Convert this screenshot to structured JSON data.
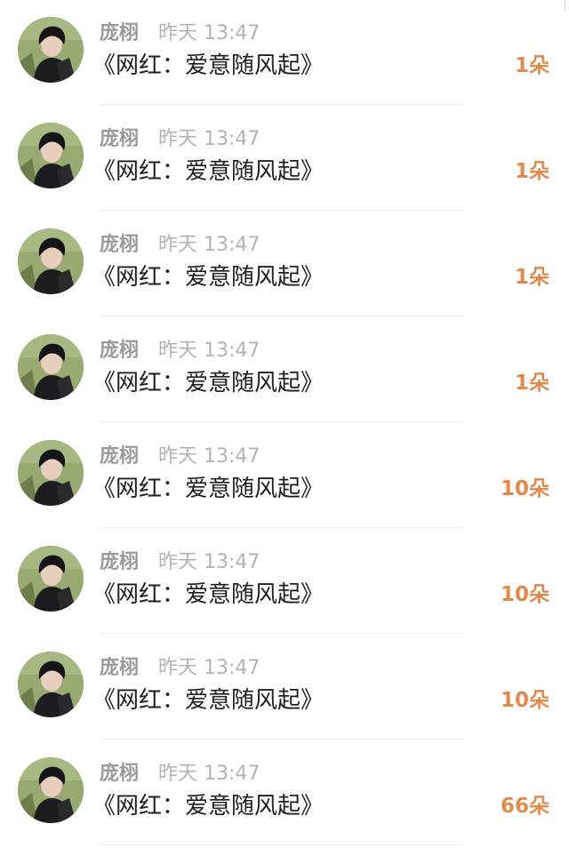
{
  "colors": {
    "name": "#9a9a9a",
    "time": "#b3b3b3",
    "title": "#1f1f1f",
    "amount": "#e08a4e",
    "divider": "#ededed"
  },
  "gifts": [
    {
      "name": "庞栩",
      "time": "昨天 13:47",
      "title": "《网红：爱意随风起》",
      "amount": "1朵",
      "avatar": "user-avatar"
    },
    {
      "name": "庞栩",
      "time": "昨天 13:47",
      "title": "《网红：爱意随风起》",
      "amount": "1朵",
      "avatar": "user-avatar"
    },
    {
      "name": "庞栩",
      "time": "昨天 13:47",
      "title": "《网红：爱意随风起》",
      "amount": "1朵",
      "avatar": "user-avatar"
    },
    {
      "name": "庞栩",
      "time": "昨天 13:47",
      "title": "《网红：爱意随风起》",
      "amount": "1朵",
      "avatar": "user-avatar"
    },
    {
      "name": "庞栩",
      "time": "昨天 13:47",
      "title": "《网红：爱意随风起》",
      "amount": "10朵",
      "avatar": "user-avatar"
    },
    {
      "name": "庞栩",
      "time": "昨天 13:47",
      "title": "《网红：爱意随风起》",
      "amount": "10朵",
      "avatar": "user-avatar"
    },
    {
      "name": "庞栩",
      "time": "昨天 13:47",
      "title": "《网红：爱意随风起》",
      "amount": "10朵",
      "avatar": "user-avatar"
    },
    {
      "name": "庞栩",
      "time": "昨天 13:47",
      "title": "《网红：爱意随风起》",
      "amount": "66朵",
      "avatar": "user-avatar"
    }
  ]
}
